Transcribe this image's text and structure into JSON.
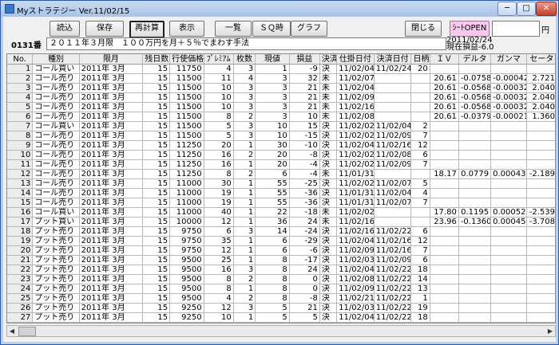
{
  "window": {
    "title": "Myストラテジー Ver.11/02/15",
    "btn_min": "─",
    "btn_max": "□",
    "btn_close": "✕"
  },
  "toolbar": {
    "load": "読込",
    "save": "保存",
    "recalc": "再計算",
    "show": "表示",
    "list": "一覧",
    "sq": "ＳＱ時",
    "graph": "グラフ",
    "close": "閉じる",
    "sheet": "ｼｰﾄOPEN",
    "unit": "円",
    "price_value": ""
  },
  "info": {
    "number": "0131番",
    "strategy": "２０１１年３月限　１００万円を月＋５％でまわす手法",
    "date": "2011/02/24",
    "current_pl": "現在損益-6.0"
  },
  "table": {
    "headers": [
      "No.",
      "種別",
      "限月",
      "残日数",
      "行使価格",
      "ﾌﾟﾚﾐｱﾑ",
      "枚数",
      "現値",
      "損益",
      "決済",
      "仕掛日付",
      "決済日付",
      "日柄",
      "ＩＶ",
      "デルタ",
      "ガンマ",
      "セータ"
    ],
    "rows": [
      [
        "1",
        "コール買い",
        "2011年 3月",
        "15",
        "11750",
        "4",
        "3",
        "1",
        "-9",
        "決",
        "11/02/04",
        "11/02/24",
        "20",
        "",
        "",
        "",
        ""
      ],
      [
        "2",
        "コール売り",
        "2011年 3月",
        "15",
        "11500",
        "11",
        "4",
        "3",
        "32",
        "未",
        "11/02/07",
        "",
        "",
        "20.61",
        "-0.0758",
        "-0.00042",
        "2.721"
      ],
      [
        "3",
        "コール売り",
        "2011年 3月",
        "15",
        "11500",
        "10",
        "3",
        "3",
        "21",
        "未",
        "11/02/04",
        "",
        "",
        "20.61",
        "-0.0568",
        "-0.00032",
        "2.040"
      ],
      [
        "4",
        "コール売り",
        "2011年 3月",
        "15",
        "11500",
        "10",
        "3",
        "3",
        "21",
        "未",
        "11/02/09",
        "",
        "",
        "20.61",
        "-0.0568",
        "-0.00032",
        "2.040"
      ],
      [
        "5",
        "コール売り",
        "2011年 3月",
        "15",
        "11500",
        "10",
        "3",
        "3",
        "21",
        "未",
        "11/02/16",
        "",
        "",
        "20.61",
        "-0.0568",
        "-0.00032",
        "2.040"
      ],
      [
        "6",
        "コール売り",
        "2011年 3月",
        "15",
        "11500",
        "8",
        "2",
        "3",
        "10",
        "未",
        "11/02/08",
        "",
        "",
        "20.61",
        "-0.0379",
        "-0.00021",
        "1.360"
      ],
      [
        "7",
        "コール買い",
        "2011年 3月",
        "15",
        "11500",
        "5",
        "3",
        "10",
        "15",
        "決",
        "11/02/02",
        "11/02/04",
        "2",
        "",
        "",
        "",
        ""
      ],
      [
        "8",
        "コール売り",
        "2011年 3月",
        "15",
        "11500",
        "5",
        "3",
        "10",
        "-15",
        "決",
        "11/02/02",
        "11/02/09",
        "7",
        "",
        "",
        "",
        ""
      ],
      [
        "9",
        "コール売り",
        "2011年 3月",
        "15",
        "11250",
        "20",
        "1",
        "30",
        "-10",
        "決",
        "11/02/04",
        "11/02/16",
        "12",
        "",
        "",
        "",
        ""
      ],
      [
        "10",
        "コール売り",
        "2011年 3月",
        "15",
        "11250",
        "16",
        "2",
        "20",
        "-8",
        "決",
        "11/02/02",
        "11/02/08",
        "6",
        "",
        "",
        "",
        ""
      ],
      [
        "11",
        "コール売り",
        "2011年 3月",
        "15",
        "11250",
        "16",
        "1",
        "20",
        "-4",
        "決",
        "11/02/02",
        "11/02/09",
        "7",
        "",
        "",
        "",
        ""
      ],
      [
        "12",
        "コール売り",
        "2011年 3月",
        "15",
        "11250",
        "8",
        "2",
        "6",
        "-4",
        "未",
        "11/01/31",
        "",
        "",
        "18.17",
        "0.0779",
        "0.00043",
        "-2.189"
      ],
      [
        "13",
        "コール売り",
        "2011年 3月",
        "15",
        "11000",
        "30",
        "1",
        "55",
        "-25",
        "決",
        "11/02/02",
        "11/02/07",
        "5",
        "",
        "",
        "",
        ""
      ],
      [
        "14",
        "コール売り",
        "2011年 3月",
        "15",
        "11000",
        "19",
        "1",
        "55",
        "-36",
        "決",
        "11/01/31",
        "11/02/04",
        "4",
        "",
        "",
        "",
        ""
      ],
      [
        "15",
        "コール売り",
        "2011年 3月",
        "15",
        "11000",
        "19",
        "1",
        "55",
        "-36",
        "決",
        "11/01/31",
        "11/02/07",
        "7",
        "",
        "",
        "",
        ""
      ],
      [
        "16",
        "コール買い",
        "2011年 3月",
        "15",
        "11000",
        "40",
        "1",
        "22",
        "-18",
        "未",
        "11/02/02",
        "",
        "",
        "17.80",
        "0.1195",
        "0.00052",
        "-2.539"
      ],
      [
        "17",
        "プット買い",
        "2011年 3月",
        "15",
        "10000",
        "12",
        "1",
        "36",
        "24",
        "未",
        "11/02/16",
        "",
        "",
        "23.96",
        "-0.1360",
        "0.00045",
        "-3.708"
      ],
      [
        "18",
        "プット売り",
        "2011年 3月",
        "15",
        "9750",
        "6",
        "3",
        "14",
        "-24",
        "決",
        "11/02/16",
        "11/02/22",
        "6",
        "",
        "",
        "",
        ""
      ],
      [
        "19",
        "プット売り",
        "2011年 3月",
        "15",
        "9750",
        "35",
        "1",
        "6",
        "-29",
        "決",
        "11/02/04",
        "11/02/16",
        "12",
        "",
        "",
        "",
        ""
      ],
      [
        "20",
        "プット売り",
        "2011年 3月",
        "15",
        "9750",
        "12",
        "1",
        "6",
        "-6",
        "決",
        "11/02/09",
        "11/02/16",
        "7",
        "",
        "",
        "",
        ""
      ],
      [
        "21",
        "プット売り",
        "2011年 3月",
        "15",
        "9500",
        "25",
        "1",
        "8",
        "-17",
        "決",
        "11/02/03",
        "11/02/09",
        "6",
        "",
        "",
        "",
        ""
      ],
      [
        "22",
        "プット売り",
        "2011年 3月",
        "15",
        "9500",
        "16",
        "3",
        "8",
        "24",
        "決",
        "11/02/04",
        "11/02/22",
        "18",
        "",
        "",
        "",
        ""
      ],
      [
        "23",
        "プット売り",
        "2011年 3月",
        "15",
        "9500",
        "8",
        "2",
        "8",
        "0",
        "決",
        "11/02/08",
        "11/02/22",
        "14",
        "",
        "",
        "",
        ""
      ],
      [
        "24",
        "プット売り",
        "2011年 3月",
        "15",
        "9500",
        "8",
        "1",
        "8",
        "0",
        "決",
        "11/02/09",
        "11/02/22",
        "13",
        "",
        "",
        "",
        ""
      ],
      [
        "25",
        "プット売り",
        "2011年 3月",
        "15",
        "9500",
        "4",
        "2",
        "8",
        "-8",
        "決",
        "11/02/21",
        "11/02/22",
        "1",
        "",
        "",
        "",
        ""
      ],
      [
        "26",
        "プット売り",
        "2011年 3月",
        "15",
        "9250",
        "12",
        "3",
        "5",
        "21",
        "決",
        "11/02/03",
        "11/02/22",
        "19",
        "",
        "",
        "",
        ""
      ],
      [
        "27",
        "プット売り",
        "2011年 3月",
        "15",
        "9250",
        "10",
        "1",
        "5",
        "5",
        "決",
        "11/02/04",
        "11/02/22",
        "18",
        "",
        "",
        "",
        ""
      ],
      [
        "28",
        "プット売り",
        "2011年 3月",
        "15",
        "9250",
        "6",
        "1",
        "5",
        "1",
        "決",
        "11/02/08",
        "11/02/22",
        "14",
        "",
        "",
        "",
        ""
      ]
    ]
  }
}
